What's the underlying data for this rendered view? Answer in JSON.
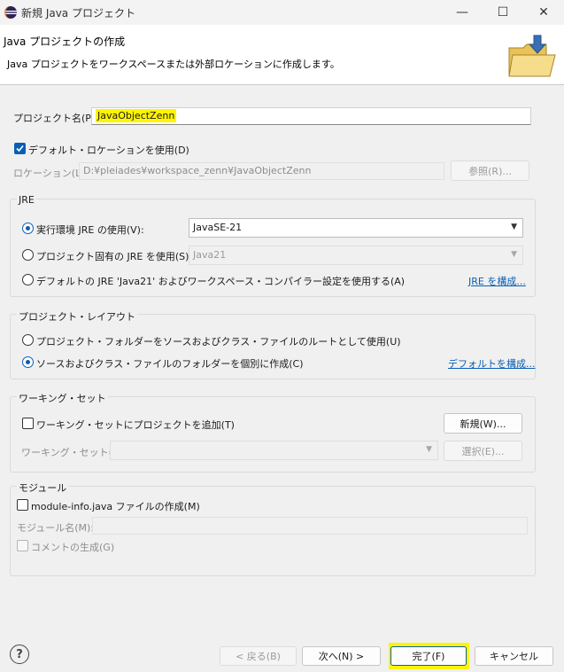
{
  "window": {
    "title": "新規 Java プロジェクト",
    "minimize_icon": "—",
    "maximize_icon": "☐",
    "close_icon": "✕"
  },
  "header": {
    "title": "Java プロジェクトの作成",
    "description": "Java プロジェクトをワークスペースまたは外部ロケーションに作成します。",
    "icon": "folder-wizard-icon"
  },
  "project": {
    "name_label": "プロジェクト名(P):",
    "name_value": "JavaObjectZenn",
    "default_location_label": "デフォルト・ロケーションを使用(D)",
    "default_location_checked": true,
    "location_label": "ロケーション(L):",
    "location_value": "D:¥pleiades¥workspace_zenn¥JavaObjectZenn",
    "browse_label": "参照(R)..."
  },
  "jre": {
    "group_title": "JRE",
    "option_env_label": "実行環境 JRE の使用(V):",
    "option_env_value": "JavaSE-21",
    "option_specific_label": "プロジェクト固有の JRE を使用(S):",
    "option_specific_value": "Java21",
    "option_default_label": "デフォルトの JRE 'Java21' およびワークスペース・コンパイラー設定を使用する(A)",
    "configure_link": "JRE を構成...",
    "selected": "env"
  },
  "layout": {
    "group_title": "プロジェクト・レイアウト",
    "option_root_label": "プロジェクト・フォルダーをソースおよびクラス・ファイルのルートとして使用(U)",
    "option_separate_label": "ソースおよびクラス・ファイルのフォルダーを個別に作成(C)",
    "configure_link": "デフォルトを構成...",
    "selected": "separate"
  },
  "working_set": {
    "group_title": "ワーキング・セット",
    "add_label": "ワーキング・セットにプロジェクトを追加(T)",
    "add_checked": false,
    "new_button": "新規(W)...",
    "set_label": "ワーキング・セット(O):",
    "set_value": "",
    "select_button": "選択(E)..."
  },
  "module": {
    "group_title": "モジュール",
    "create_label": "module-info.java ファイルの作成(M)",
    "create_checked": false,
    "name_label": "モジュール名(M):",
    "name_value": "",
    "comment_label": "コメントの生成(G)"
  },
  "footer": {
    "help_icon": "?",
    "back_button": "< 戻る(B)",
    "next_button": "次へ(N) >",
    "finish_button": "完了(F)",
    "cancel_button": "キャンセル"
  },
  "colors": {
    "accent": "#0a5fb4",
    "highlight": "#fff400",
    "background": "#f0f0f0"
  }
}
